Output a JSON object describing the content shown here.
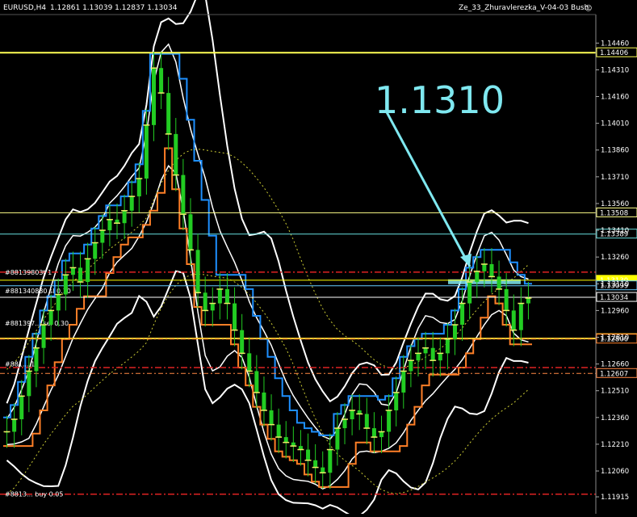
{
  "header": {
    "symbol": "EURUSD,H4",
    "ohlc": "1.12861 1.13039 1.12837 1.13034",
    "indicator": "Ze_33_Zhuravlerezka_V-04-03 Bush",
    "smiley": "☺"
  },
  "annotation": {
    "text": "1.1310",
    "color": "#7fe8f0"
  },
  "colors": {
    "background": "#000000",
    "candles": "#22cc22",
    "bollinger": "#ffffff",
    "channel_upper": "#1e90ff",
    "channel_lower": "#ff7f27",
    "ma_dotted": "#cccc33"
  },
  "chart_data": {
    "type": "line",
    "title": "",
    "ylim": [
      1.1182,
      1.1462
    ],
    "y_ticks": [
      "1.14460",
      "1.14310",
      "1.14160",
      "1.14010",
      "1.13860",
      "1.13710",
      "1.13560",
      "1.13410",
      "1.13260",
      "1.13110",
      "1.12960",
      "1.12810",
      "1.12660",
      "1.12510",
      "1.12360",
      "1.12210",
      "1.12060",
      "1.11915"
    ],
    "price_levels": [
      {
        "label": "1.14406",
        "value": 1.14406,
        "color": "#ffff55"
      },
      {
        "label": "1.13508",
        "value": 1.13508,
        "color": "#ffff88"
      },
      {
        "label": "1.13389",
        "value": 1.13389,
        "color": "#66dddd"
      },
      {
        "label": "1.13130",
        "value": 1.1313,
        "color": "#ffff00"
      },
      {
        "label": "1.13099",
        "value": 1.13099,
        "color": "#66ccff"
      },
      {
        "label": "1.13034",
        "value": 1.13034,
        "color": "#ffffff"
      },
      {
        "label": "1.12803",
        "value": 1.12803,
        "color": "#ffcc33"
      },
      {
        "label": "1.12800",
        "value": 1.128,
        "color": "#ff7f27"
      },
      {
        "label": "1.12607",
        "value": 1.12607,
        "color": "#ff8844"
      }
    ],
    "order_lines": [
      {
        "label": "#88139803t 1",
        "value": 1.13175
      },
      {
        "label": "#881340830 sl 0.10",
        "value": 1.1307
      },
      {
        "label": "#881397... sel 0.30",
        "value": 1.1289
      },
      {
        "label": "#881... 1",
        "value": 1.1266
      },
      {
        "label": "#8813... buy 0.05",
        "value": 1.1193
      }
    ],
    "series": [
      {
        "name": "Close",
        "values": [
          1.1228,
          1.1235,
          1.1248,
          1.1262,
          1.1275,
          1.1288,
          1.1296,
          1.1305,
          1.1316,
          1.132,
          1.1312,
          1.1325,
          1.1334,
          1.1341,
          1.1347,
          1.1345,
          1.1352,
          1.136,
          1.137,
          1.14,
          1.1432,
          1.1418,
          1.1395,
          1.1372,
          1.135,
          1.133,
          1.1306,
          1.1296,
          1.13,
          1.1308,
          1.13,
          1.1285,
          1.1272,
          1.1262,
          1.125,
          1.124,
          1.1232,
          1.1225,
          1.1222,
          1.122,
          1.1218,
          1.1212,
          1.1208,
          1.1205,
          1.1218,
          1.123,
          1.1235,
          1.124,
          1.1238,
          1.123,
          1.1225,
          1.1228,
          1.124,
          1.125,
          1.1262,
          1.1268,
          1.1272,
          1.1275,
          1.1268,
          1.1272,
          1.128,
          1.1288,
          1.13,
          1.1312,
          1.1318,
          1.1322,
          1.1315,
          1.1308,
          1.1296,
          1.1285,
          1.13,
          1.1303
        ]
      }
    ]
  }
}
